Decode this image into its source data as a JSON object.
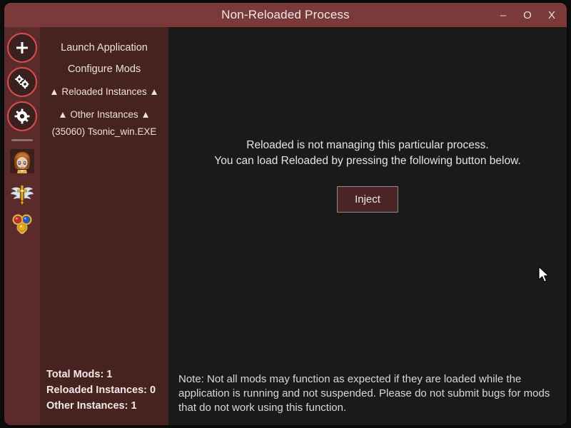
{
  "window": {
    "title": "Non-Reloaded Process",
    "controls": [
      {
        "name": "minimize-button",
        "glyph": "–"
      },
      {
        "name": "maximize-button",
        "glyph": "O"
      },
      {
        "name": "close-button",
        "glyph": "X"
      }
    ]
  },
  "rail": {
    "items": [
      {
        "name": "add-application-icon",
        "label": "+"
      },
      {
        "name": "manage-mods-icon",
        "label": "gears"
      },
      {
        "name": "settings-gear-icon",
        "label": "gear"
      },
      {
        "name": "mod-icon-character",
        "label": "character-mod"
      },
      {
        "name": "mod-icon-winged-cross",
        "label": "winged-cross-mod"
      },
      {
        "name": "mod-icon-orbs",
        "label": "orbs-mod"
      }
    ]
  },
  "sidebar": {
    "nav": [
      {
        "label": "Launch Application",
        "type": "item"
      },
      {
        "label": "Configure Mods",
        "type": "item"
      },
      {
        "label": "▲ Reloaded Instances ▲",
        "type": "header"
      },
      {
        "label": "▲ Other Instances ▲",
        "type": "header"
      },
      {
        "label": "(35060) Tsonic_win.EXE",
        "type": "child"
      }
    ],
    "stats": [
      "Total Mods: 1",
      "Reloaded Instances: 0",
      "Other Instances: 1"
    ]
  },
  "main": {
    "message_line_1": "Reloaded is not managing this particular process.",
    "message_line_2": "You can load Reloaded by pressing the following button below.",
    "inject_button": "Inject",
    "note": "Note: Not all mods may function as expected if they are loaded while the application is running and not suspended. Please do not submit bugs for mods that do not work using this function."
  },
  "colors": {
    "titlebar": "#7a3a3a",
    "rail": "#5b2b2b",
    "panel": "#46231f",
    "main": "#1a1a1a",
    "accent_ring": "#d94f4f",
    "button_fill": "#4b2525",
    "button_border": "#8d8d8d"
  }
}
